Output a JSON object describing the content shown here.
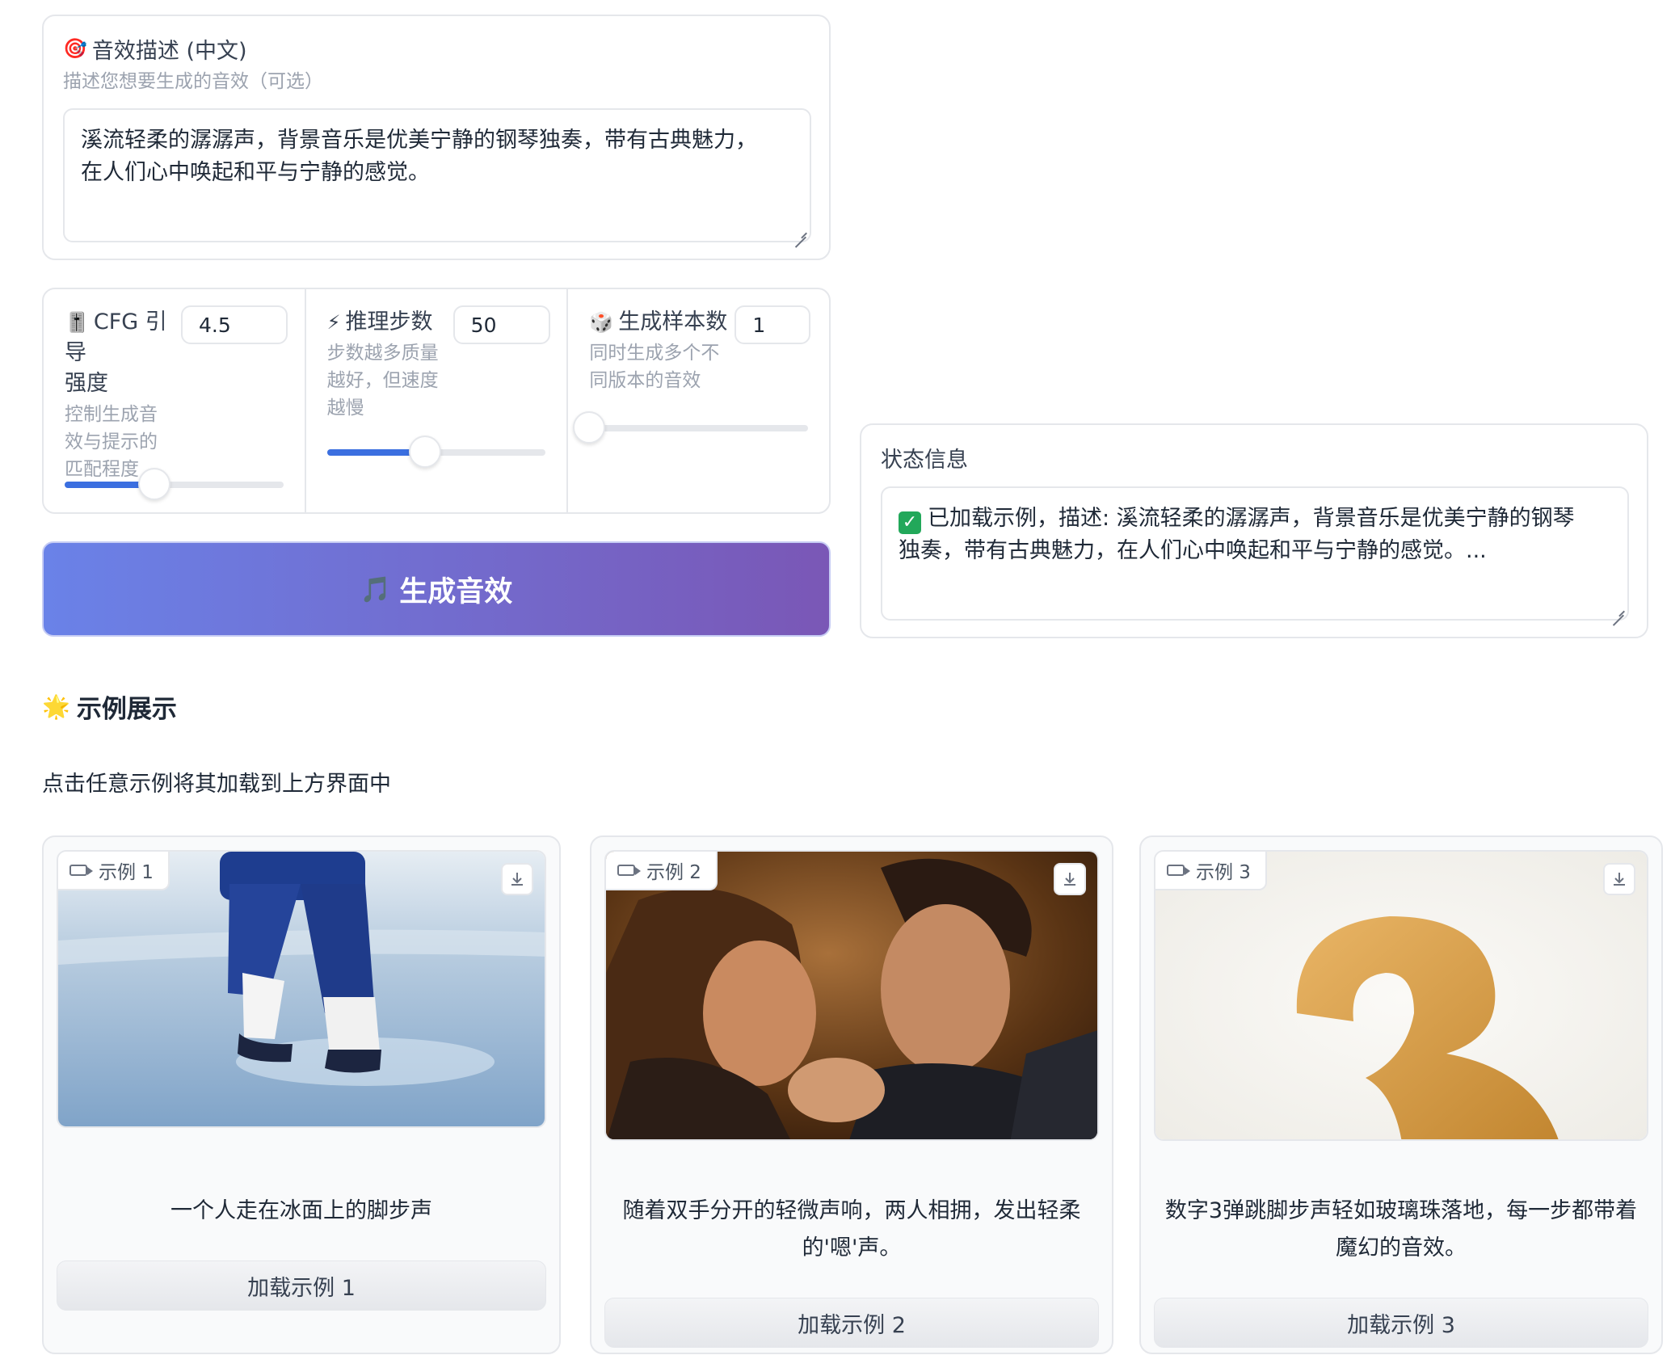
{
  "description": {
    "emoji": "🎯",
    "label": "音效描述 (中文)",
    "info": "描述您想要生成的音效（可选）",
    "value_line1": "溪流轻柔的潺潺声，背景音乐是优美宁静的钢琴独奏，带有古典魅力，",
    "value_line2": "在人们心中唤起和平与宁静的感觉。"
  },
  "params": {
    "cfg": {
      "emoji": "🎚️",
      "label_line1": "CFG 引导",
      "label_line2": "强度",
      "info": [
        "控制生成音",
        "效与提示的",
        "匹配程度"
      ],
      "value": "4.5",
      "slider_fraction": 0.41
    },
    "steps": {
      "emoji": "⚡",
      "label": "推理步数",
      "info": [
        "步数越多质量",
        "越好，但速度",
        "越慢"
      ],
      "value": "50",
      "slider_fraction": 0.45
    },
    "samples": {
      "emoji": "🎲",
      "label": "生成样本数",
      "info": [
        "同时生成多个不",
        "同版本的音效"
      ],
      "value": "1",
      "slider_fraction": 0.0
    }
  },
  "generate_button": {
    "emoji": "🎵",
    "label": "生成音效"
  },
  "status": {
    "label": "状态信息",
    "line1": "已加载示例，描述: 溪流轻柔的潺潺声，背景音乐是优美宁静的钢琴",
    "line2": "独奏，带有古典魅力，在人们心中唤起和平与宁静的感觉。..."
  },
  "examples": {
    "emoji": "🌟",
    "title": "示例展示",
    "hint": "点击任意示例将其加载到上方界面中",
    "items": [
      {
        "tag": "示例 1",
        "caption_line1": "一个人走在冰面上的脚步声",
        "caption_line2": "",
        "button": "加载示例 1"
      },
      {
        "tag": "示例 2",
        "caption_line1": "随着双手分开的轻微声响，两人相拥，发出轻柔",
        "caption_line2": "的'嗯'声。",
        "button": "加载示例 2"
      },
      {
        "tag": "示例 3",
        "caption_line1": "数字3弹跳脚步声轻如玻璃珠落地，每一步都带着",
        "caption_line2": "魔幻的音效。",
        "button": "加载示例 3"
      }
    ]
  },
  "colors": {
    "accent": "#3b6fe0",
    "button_start": "#6a82e8",
    "button_end": "#7a57b6"
  }
}
